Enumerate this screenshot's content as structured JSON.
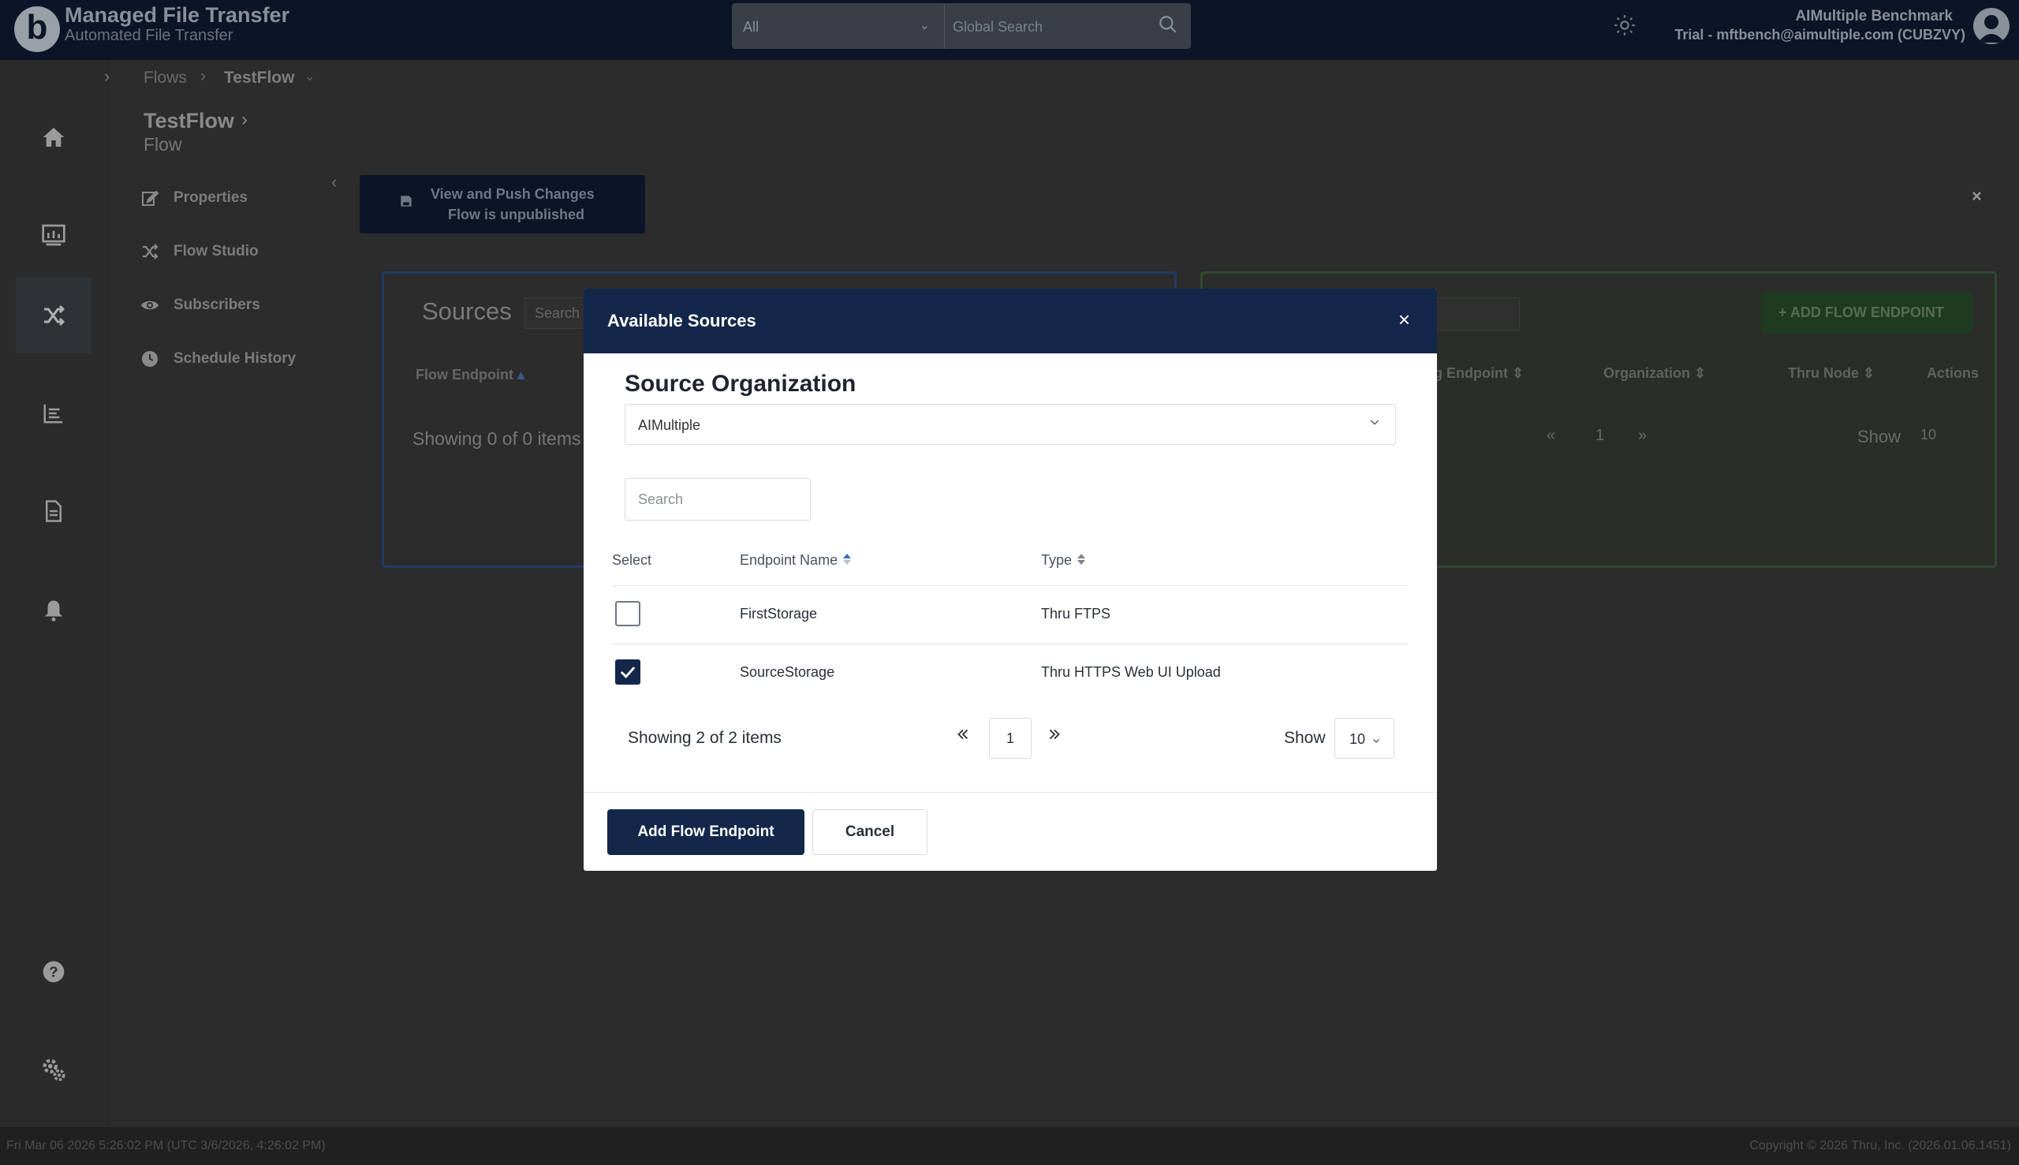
{
  "header": {
    "app_title": "Managed File Transfer",
    "app_subtitle": "Automated File Transfer",
    "logo_letter": "b",
    "search_scope": "All",
    "search_placeholder": "Global Search",
    "account_name": "AIMultiple Benchmark",
    "account_detail": "Trial - mftbench@aimultiple.com (CUBZVY)"
  },
  "breadcrumb": {
    "toggle": "›",
    "flows": "Flows",
    "separator": "›",
    "current": "TestFlow",
    "caret": "⌄"
  },
  "flow": {
    "name": "TestFlow",
    "chevron": "›",
    "kind": "Flow",
    "nav": [
      {
        "label": "Properties",
        "icon": "edit-icon"
      },
      {
        "label": "Flow Studio",
        "icon": "shuffle-icon"
      },
      {
        "label": "Subscribers",
        "icon": "eye-icon"
      },
      {
        "label": "Schedule History",
        "icon": "clock-icon"
      }
    ],
    "collapse": "‹",
    "push_line1": "View and Push Changes",
    "push_line2": "Flow is unpublished",
    "close": "×"
  },
  "sources_panel": {
    "title": "Sources",
    "search_placeholder": "Search",
    "column": "Flow Endpoint",
    "count": "Showing 0 of 0 items"
  },
  "targets_panel": {
    "add_button": "+ ADD FLOW ENDPOINT",
    "columns": [
      "rg Endpoint",
      "Organization",
      "Thru Node",
      "Actions"
    ],
    "pager_first": "«",
    "page": "1",
    "pager_last": "»",
    "show": "Show",
    "page_size": "10"
  },
  "modal": {
    "title": "Available Sources",
    "close": "×",
    "org_label": "Source Organization",
    "org_value": "AIMultiple",
    "search_placeholder": "Search",
    "columns": {
      "select": "Select",
      "name": "Endpoint Name",
      "type": "Type"
    },
    "rows": [
      {
        "name": "FirstStorage",
        "type": "Thru FTPS",
        "checked": false
      },
      {
        "name": "SourceStorage",
        "type": "Thru HTTPS Web UI Upload",
        "checked": true
      }
    ],
    "showing": "Showing 2 of 2 items",
    "page": "1",
    "show_label": "Show",
    "page_size": "10",
    "add_button": "Add Flow Endpoint",
    "cancel_button": "Cancel"
  },
  "footer": {
    "left": "Fri Mar 06 2026 5:26:02 PM (UTC 3/6/2026, 4:26:02 PM)",
    "right": "Copyright © 2026 Thru, Inc. (2026.01.06.1451)"
  },
  "colors": {
    "navy": "#13274a",
    "header_bg": "#0b1527",
    "backdrop": "#2c2c2c"
  }
}
